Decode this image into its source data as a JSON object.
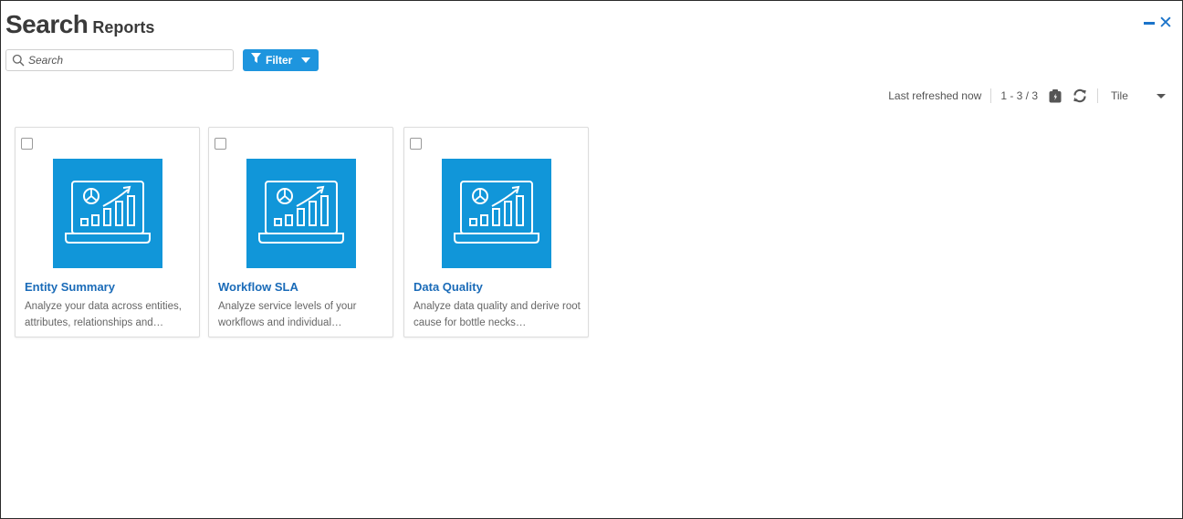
{
  "header": {
    "title": "Search",
    "subtitle": "Reports"
  },
  "search": {
    "placeholder": "Search",
    "value": ""
  },
  "filter": {
    "label": "Filter"
  },
  "toolbar": {
    "refreshed_text": "Last refreshed now",
    "range_text": "1 - 3 / 3",
    "view_mode": "Tile"
  },
  "colors": {
    "accent": "#1e95de",
    "tile_image_bg": "#1196d9",
    "link": "#1a6bb8"
  },
  "tiles": [
    {
      "title": "Entity Summary",
      "description": "Analyze your data across entities, attributes, relationships and…",
      "icon": "analytics-laptop-icon"
    },
    {
      "title": "Workflow SLA",
      "description": "Analyze service levels of your workflows and individual…",
      "icon": "analytics-laptop-icon"
    },
    {
      "title": "Data Quality",
      "description": "Analyze data quality and derive root cause for bottle necks…",
      "icon": "analytics-laptop-icon"
    }
  ]
}
